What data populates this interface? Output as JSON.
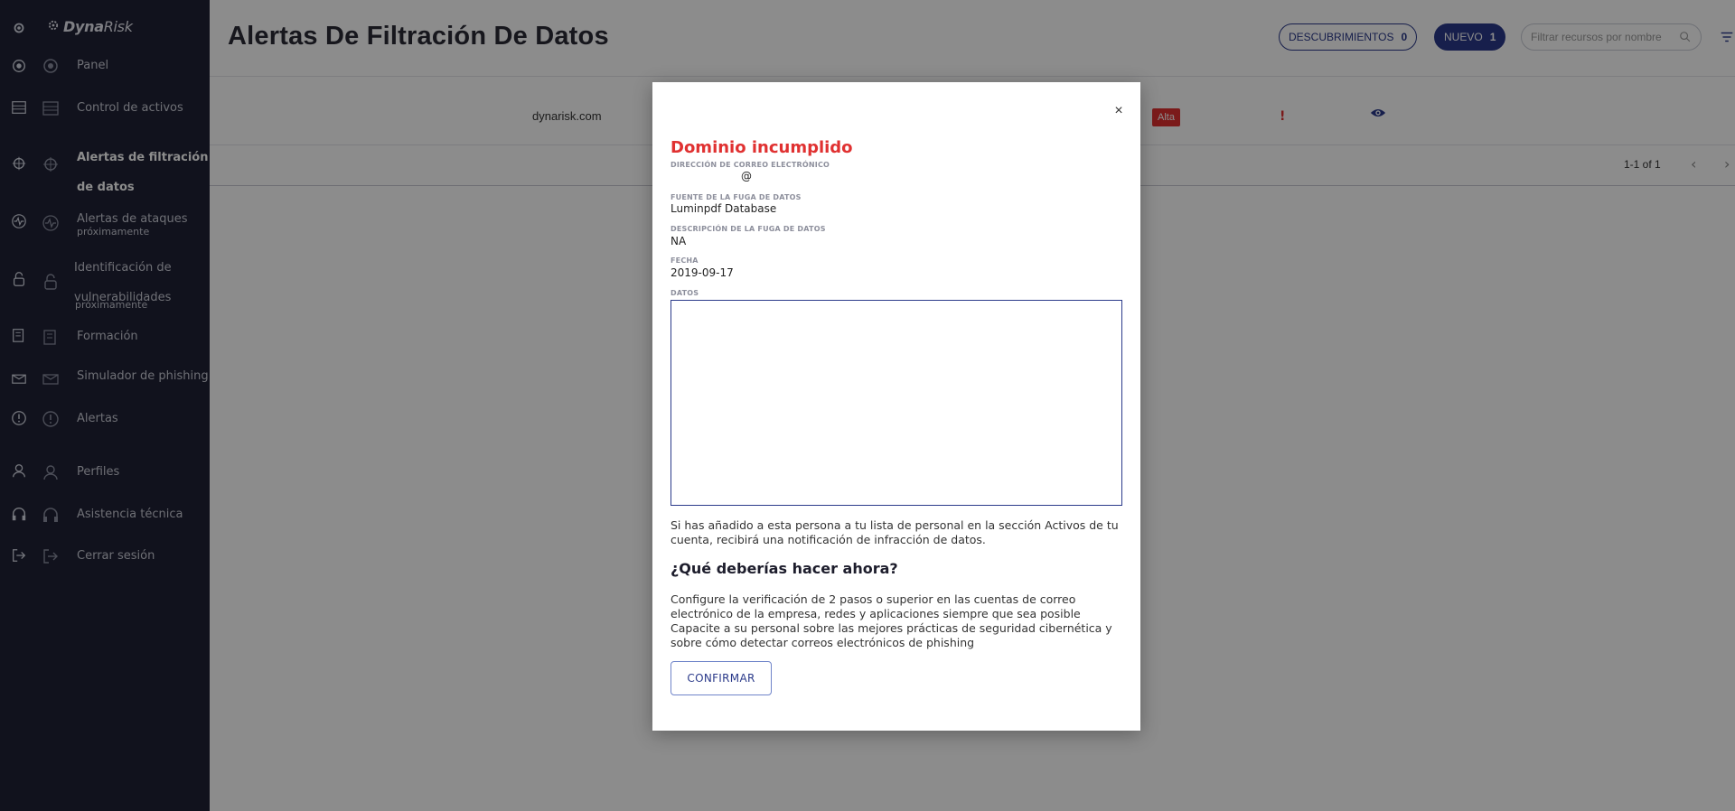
{
  "sidebar": {
    "brand": {
      "prefix": "Dyna",
      "suffix": "Risk"
    },
    "items": [
      {
        "label": "Panel",
        "sub": "",
        "icon": "dashboard-icon"
      },
      {
        "label": "Control de activos",
        "sub": "",
        "icon": "assets-icon"
      },
      {
        "label": "Alertas de filtración",
        "label2": "de datos",
        "sub": "",
        "icon": "bug-icon"
      },
      {
        "label": "Alertas de ataques",
        "sub": "próximamente",
        "icon": "activity-icon"
      },
      {
        "label": "Identificación de",
        "label2": "vulnerabilidades",
        "sub": "próximamente",
        "icon": "lock-icon"
      },
      {
        "label": "Formación",
        "sub": "",
        "icon": "training-icon"
      },
      {
        "label": "Simulador de phishing",
        "sub": "",
        "icon": "phishing-icon"
      },
      {
        "label": "Alertas",
        "sub": "",
        "icon": "alert-icon"
      },
      {
        "label": "Perfiles",
        "sub": "",
        "icon": "user-icon"
      },
      {
        "label": "Asistencia técnica",
        "sub": "",
        "icon": "headset-icon"
      },
      {
        "label": "Cerrar sesión",
        "sub": "",
        "icon": "logout-icon"
      }
    ]
  },
  "header": {
    "title": "Alertas De Filtración De Datos",
    "discoveries_label": "DESCUBRIMIENTOS",
    "discoveries_count": "0",
    "new_label": "NUEVO",
    "new_count": "1",
    "search_placeholder": "Filtrar recursos por nombre"
  },
  "table": {
    "row": {
      "domain": "dynarisk.com",
      "severity": "Alta",
      "flag": "!"
    },
    "pagination": "1-1 of 1"
  },
  "modal": {
    "title": "Dominio incumplido",
    "email_label": "DIRECCIÓN DE CORREO ELECTRÓNICO",
    "email_value": "@",
    "source_label": "FUENTE DE LA FUGA DE DATOS",
    "source_value": "Luminpdf Database",
    "description_label": "DESCRIPCIÓN DE LA FUGA DE DATOS",
    "description_value": "NA",
    "date_label": "FECHA",
    "date_value": "2019-09-17",
    "data_label": "DATOS",
    "data_value": "",
    "info_text": "Si has añadido a esta persona a tu lista de personal en la sección Activos de tu cuenta, recibirá una notificación de infracción de datos.",
    "what_now_heading": "¿Qué deberías hacer ahora?",
    "advice_1": "Configure la verificación de 2 pasos o superior en las cuentas de correo electrónico de la empresa, redes y aplicaciones siempre que sea posible",
    "advice_2": "Capacite a su personal sobre las mejores prácticas de seguridad cibernética y sobre cómo detectar correos electrónicos de phishing",
    "confirm_label": "CONFIRMAR",
    "close_symbol": "×"
  },
  "colors": {
    "sidebar_bg": "#1f2235",
    "accent": "#2b3a8a",
    "danger": "#e03131",
    "overlay": "rgba(0,0,0,0.45)"
  }
}
